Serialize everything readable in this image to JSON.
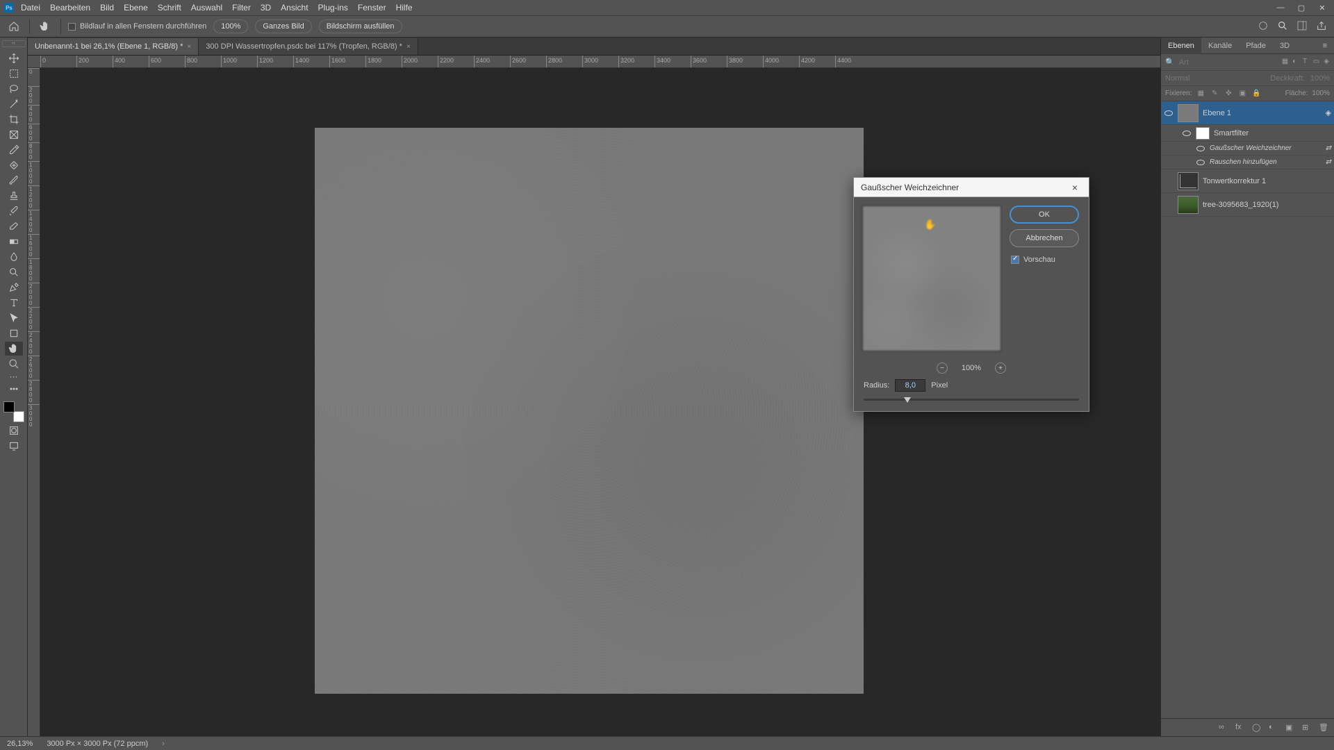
{
  "menu": {
    "datei": "Datei",
    "bearbeiten": "Bearbeiten",
    "bild": "Bild",
    "ebene": "Ebene",
    "schrift": "Schrift",
    "auswahl": "Auswahl",
    "filter": "Filter",
    "dreid": "3D",
    "ansicht": "Ansicht",
    "plugins": "Plug-ins",
    "fenster": "Fenster",
    "hilfe": "Hilfe"
  },
  "options": {
    "scroll_all": "Bildlauf in allen Fenstern durchführen",
    "hundred": "100%",
    "fit": "Ganzes Bild",
    "fill": "Bildschirm ausfüllen"
  },
  "tabs": {
    "tab1": "Unbenannt-1 bei 26,1% (Ebene 1, RGB/8) *",
    "tab2": "300 DPI Wassertropfen.psdc bei 117% (Tropfen, RGB/8) *"
  },
  "ruler_h": [
    "0",
    "200",
    "400",
    "600",
    "800",
    "1000",
    "1200",
    "1400",
    "1600",
    "1800",
    "2000",
    "2200",
    "2400",
    "2600",
    "2800",
    "3000",
    "3200",
    "3400",
    "3600",
    "3800",
    "4000",
    "4200",
    "4400"
  ],
  "ruler_v": [
    "0",
    "200",
    "400",
    "600",
    "800",
    "1000",
    "1200",
    "1400",
    "1600",
    "1800",
    "2000",
    "2200",
    "2400",
    "2600",
    "2800",
    "3000"
  ],
  "panels": {
    "tab_ebenen": "Ebenen",
    "tab_kanaele": "Kanäle",
    "tab_pfade": "Pfade",
    "tab_3d": "3D",
    "search_placeholder": "Art",
    "blend_mode": "Normal",
    "opacity_label": "Deckkraft:",
    "opacity_val": "100%",
    "lock_label": "Fixieren:",
    "fill_label": "Fläche:",
    "fill_val": "100%"
  },
  "layers": {
    "l1": "Ebene 1",
    "l1_sf": "Smartfilter",
    "l1_f1": "Gaußscher Weichzeichner",
    "l1_f2": "Rauschen hinzufügen",
    "l2": "Tonwertkorrektur 1",
    "l3": "tree-3095683_1920(1)"
  },
  "dialog": {
    "title": "Gaußscher Weichzeichner",
    "ok": "OK",
    "cancel": "Abbrechen",
    "preview": "Vorschau",
    "zoom": "100%",
    "radius_label": "Radius:",
    "radius_val": "8,0",
    "pixel": "Pixel"
  },
  "status": {
    "zoom": "26,13%",
    "docinfo": "3000 Px × 3000 Px (72 ppcm)"
  }
}
